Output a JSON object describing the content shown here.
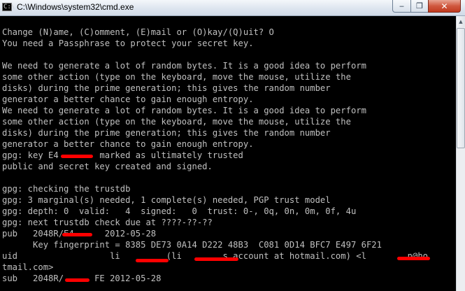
{
  "window": {
    "title": "C:\\Windows\\system32\\cmd.exe",
    "icon_glyph": "C:\\",
    "controls": {
      "minimize": "‒",
      "maximize": "❐",
      "close": "✕"
    }
  },
  "console": {
    "lines": [
      "Change (N)ame, (C)omment, (E)mail or (O)kay/(Q)uit? O",
      "You need a Passphrase to protect your secret key.",
      "",
      "We need to generate a lot of random bytes. It is a good idea to perform",
      "some other action (type on the keyboard, move the mouse, utilize the",
      "disks) during the prime generation; this gives the random number",
      "generator a better chance to gain enough entropy.",
      "We need to generate a lot of random bytes. It is a good idea to perform",
      "some other action (type on the keyboard, move the mouse, utilize the",
      "disks) during the prime generation; this gives the random number",
      "generator a better chance to gain enough entropy.",
      "gpg: key E4        marked as ultimately trusted",
      "public and secret key created and signed.",
      "",
      "gpg: checking the trustdb",
      "gpg: 3 marginal(s) needed, 1 complete(s) needed, PGP trust model",
      "gpg: depth: 0  valid:   4  signed:   0  trust: 0-, 0q, 0n, 0m, 0f, 4u",
      "gpg: next trustdb check due at ????-??-??",
      "pub   2048R/E4      2012-05-28",
      "      Key fingerprint = 8385 DE73 0A14 D222 48B3  C081 0D14 BFC7 E497 6F21",
      "uid                  li         (li        s account at hotmail.com) <l        n@ho",
      "tmail.com>",
      "sub   2048R/      FE 2012-05-28"
    ]
  }
}
